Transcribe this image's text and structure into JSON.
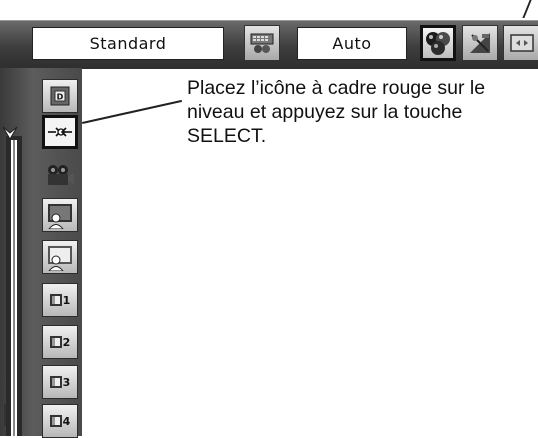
{
  "menubar": {
    "mode_value": "Standard",
    "setting_value": "Auto",
    "icons": [
      "keyboard-remote-icon",
      "color-balls-icon",
      "sliders-icon",
      "screen-icon"
    ]
  },
  "sidebar": {
    "items": [
      {
        "icon": "d-icon"
      },
      {
        "icon": "arrows-in-icon"
      },
      {
        "icon": "camera-icon"
      },
      {
        "icon": "person-dark-icon"
      },
      {
        "icon": "person-light-icon"
      },
      {
        "icon": "monitor-icon",
        "number": "1"
      },
      {
        "icon": "monitor-icon",
        "number": "2"
      },
      {
        "icon": "monitor-icon",
        "number": "3"
      },
      {
        "icon": "monitor-icon",
        "number": "4"
      }
    ],
    "selected_index": 1
  },
  "callout": {
    "text": "Placez l’icône à cadre rouge sur le niveau et appuyez sur la touche SELECT."
  }
}
